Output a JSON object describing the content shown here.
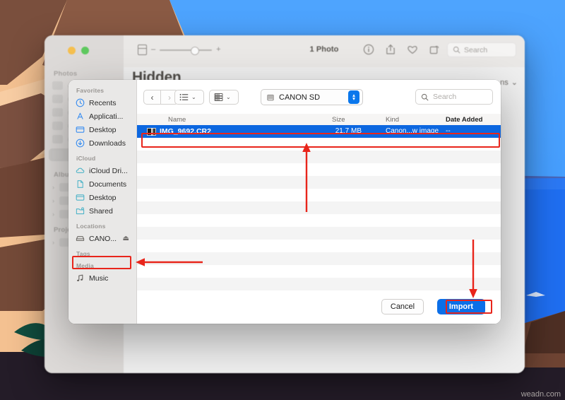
{
  "wallpaper": {
    "name": "desert-canyon-wallpaper",
    "sky_color": "#3e9bfd",
    "water_color": "#1f6ef0",
    "sand_color": "#f3c091",
    "rock_color": "#70483a",
    "cactus_color": "#5d1145"
  },
  "photos_window": {
    "traffic_lights": [
      "close",
      "minimize",
      "zoom"
    ],
    "sidebar": {
      "sections": [
        {
          "label": "Photos",
          "rows": 6
        },
        {
          "label": "Albums",
          "rows": 3
        },
        {
          "label": "Projects",
          "rows": 1
        }
      ]
    },
    "toolbar": {
      "zoom_minus": "–",
      "zoom_plus": "+",
      "photo_count": "1 Photo",
      "icons": [
        "info-icon",
        "share-icon",
        "favorite-heart-icon",
        "rotate-icon"
      ],
      "search_placeholder": "Search"
    },
    "title": "Hidden",
    "options_button": "ns"
  },
  "dialog": {
    "sidebar": {
      "groups": [
        {
          "label": "Favorites",
          "items": [
            {
              "label": "Recents",
              "icon": "clock-icon",
              "color": "#3a8ef0"
            },
            {
              "label": "Applicati...",
              "icon": "applications-icon",
              "color": "#3a8ef0"
            },
            {
              "label": "Desktop",
              "icon": "desktop-monitor-icon",
              "color": "#3a8ef0"
            },
            {
              "label": "Downloads",
              "icon": "download-arrow-icon",
              "color": "#3a8ef0"
            }
          ]
        },
        {
          "label": "iCloud",
          "items": [
            {
              "label": "iCloud Dri...",
              "icon": "cloud-icon",
              "color": "#4fb4c8"
            },
            {
              "label": "Documents",
              "icon": "document-icon",
              "color": "#4fb4c8"
            },
            {
              "label": "Desktop",
              "icon": "desktop-monitor-icon",
              "color": "#4fb4c8"
            },
            {
              "label": "Shared",
              "icon": "shared-folder-icon",
              "color": "#4fb4c8"
            }
          ]
        },
        {
          "label": "Locations",
          "items": [
            {
              "label": "CANO...",
              "icon": "external-drive-icon",
              "color": "#6d6a67",
              "eject": "⏏",
              "highlighted": true
            }
          ]
        },
        {
          "label": "Tags",
          "items": []
        },
        {
          "label": "Media",
          "items": [
            {
              "label": "Music",
              "icon": "music-note-icon",
              "color": "#6d6a67"
            }
          ]
        }
      ]
    },
    "toolbar": {
      "back_glyph": "‹",
      "forward_glyph": "›",
      "list_view_icon": "list-view-icon",
      "group_view_icon": "group-view-icon",
      "chevron": "⌄",
      "path_icon": "drive-icon",
      "path_label": "CANON SD",
      "path_chevron_up": "▴",
      "path_chevron_down": "▾",
      "search_icon": "search-icon",
      "search_placeholder": "Search"
    },
    "columns": [
      {
        "key": "name",
        "label": "Name",
        "bold": false
      },
      {
        "key": "size",
        "label": "Size",
        "bold": false
      },
      {
        "key": "kind",
        "label": "Kind",
        "bold": false
      },
      {
        "key": "date_added",
        "label": "Date Added",
        "bold": true
      }
    ],
    "files": [
      {
        "name": "IMG_9692.CR2",
        "size": "21.7 MB",
        "kind": "Canon...w image",
        "date_added": "--",
        "selected": true
      }
    ],
    "empty_row_count": 13,
    "footer": {
      "cancel_label": "Cancel",
      "import_label": "Import"
    }
  },
  "annotations": {
    "color": "#e8251b",
    "boxes": [
      {
        "name": "file-row-highlight-box"
      },
      {
        "name": "canon-sidebar-highlight-box"
      },
      {
        "name": "import-button-highlight-box"
      }
    ],
    "arrows": [
      {
        "name": "arrow-up-to-file-row",
        "direction": "up"
      },
      {
        "name": "arrow-down-to-import-button",
        "direction": "down"
      },
      {
        "name": "arrow-left-to-canon-drive",
        "direction": "left"
      }
    ]
  },
  "watermark": {
    "text": "weadn.com"
  }
}
